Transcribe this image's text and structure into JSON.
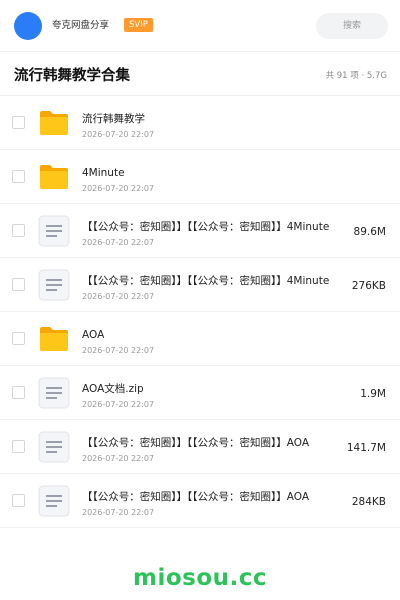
{
  "topbar": {
    "sharer_label": "夸克网盘分享",
    "badge": "SVIP",
    "search_placeholder": "搜索",
    "accent": "#2a7df6"
  },
  "header": {
    "title": "流行韩舞教学合集",
    "summary": "共 91 项 · 5.7G"
  },
  "files": [
    {
      "type": "folder",
      "name": "流行韩舞教学",
      "date": "2026-07-20 22:07",
      "size": ""
    },
    {
      "type": "folder",
      "name": "4Minute",
      "date": "2026-07-20 22:07",
      "size": ""
    },
    {
      "type": "file",
      "name": "【【公众号：密知圈】】【【公众号：密知圈】】4Minute",
      "date": "2026-07-20 22:07",
      "size": "89.6M"
    },
    {
      "type": "file",
      "name": "【【公众号：密知圈】】【【公众号：密知圈】】4Minute",
      "date": "2026-07-20 22:07",
      "size": "276KB"
    },
    {
      "type": "folder",
      "name": "AOA",
      "date": "2026-07-20 22:07",
      "size": ""
    },
    {
      "type": "file",
      "name": "AOA文档.zip",
      "date": "2026-07-20 22:07",
      "size": "1.9M"
    },
    {
      "type": "file",
      "name": "【【公众号：密知圈】】【【公众号：密知圈】】AOA",
      "date": "2026-07-20 22:07",
      "size": "141.7M"
    },
    {
      "type": "file",
      "name": "【【公众号：密知圈】】【【公众号：密知圈】】AOA",
      "date": "2026-07-20 22:07",
      "size": "284KB"
    }
  ],
  "icons": {
    "folder": "folder-icon",
    "file": "document-icon"
  },
  "watermark": "miosou.cc"
}
